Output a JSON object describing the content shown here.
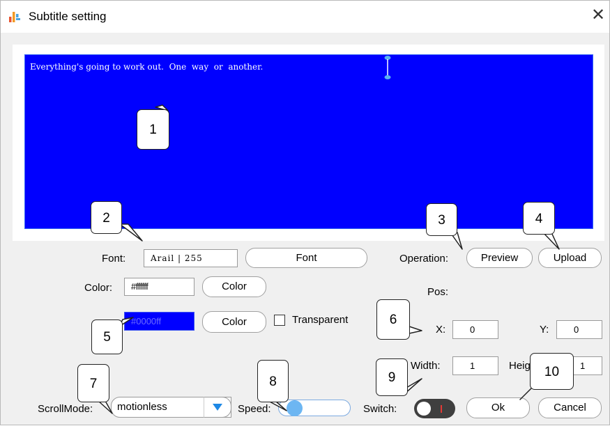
{
  "window": {
    "title": "Subtitle setting",
    "close_glyph": "✕"
  },
  "preview": {
    "text": "Everything's going to work out.  One  way  or  another.",
    "background_color": "#0000ff",
    "text_color": "#ffffff"
  },
  "font": {
    "label": "Font:",
    "value": "Arail | 255",
    "button": "Font"
  },
  "operation": {
    "label": "Operation:",
    "preview_button": "Preview",
    "upload_button": "Upload"
  },
  "text_color": {
    "label": "Color:",
    "value": "#ffffff",
    "button": "Color"
  },
  "bg_color": {
    "value": "#0000ff",
    "button": "Color",
    "transparent_label": "Transparent"
  },
  "position": {
    "label": "Pos:",
    "x_label": "X:",
    "x_value": "0",
    "y_label": "Y:",
    "y_value": "0",
    "width_label": "Width:",
    "width_value": "1",
    "height_label": "Heig",
    "height_value": "1"
  },
  "scroll": {
    "label": "ScrollMode:",
    "value": "motionless"
  },
  "speed": {
    "label": "Speed:",
    "level": 0
  },
  "switch": {
    "label": "Switch:",
    "state": "off"
  },
  "actions": {
    "ok": "Ok",
    "cancel": "Cancel"
  },
  "callouts": [
    "1",
    "2",
    "3",
    "4",
    "5",
    "6",
    "7",
    "8",
    "9",
    "10"
  ]
}
